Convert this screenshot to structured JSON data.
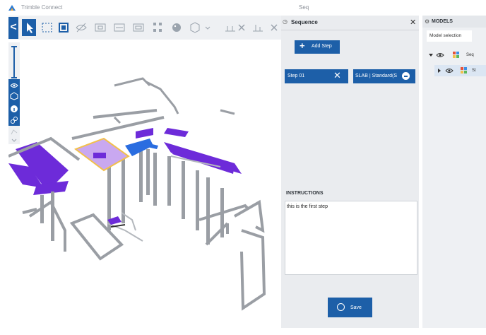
{
  "app": {
    "title": "Trimble Connect",
    "document_title": "Seq"
  },
  "toolbar": {
    "back_label": "<",
    "tools": [
      "select-icon",
      "box-select-icon",
      "fit-icon",
      "visibility-icon",
      "section-box-icon",
      "section-plane-icon",
      "measure-icon",
      "explode-icon",
      "paint-icon",
      "cube-icon",
      "dropdown-icon",
      "level-icon",
      "clear-icon",
      "level2-icon",
      "clear2-icon"
    ]
  },
  "sequence_panel": {
    "title": "Sequence",
    "add_step_label": "Add Step",
    "steps": [
      {
        "label": "Step 01",
        "object": "SLAB | Standard(S"
      }
    ],
    "instructions_title": "INSTRUCTIONS",
    "instructions_text": "this is the first step",
    "save_label": "Save"
  },
  "models_panel": {
    "title": "MODELS",
    "tab_label": "Model selection",
    "tree": [
      {
        "label": "Seq",
        "level": 0
      },
      {
        "label": "St",
        "level": 1
      }
    ]
  },
  "colors": {
    "accent": "#1d5fa8",
    "slab": "#6d2bd9",
    "highlight": "#f2c04c",
    "selected": "#2a6de0"
  }
}
